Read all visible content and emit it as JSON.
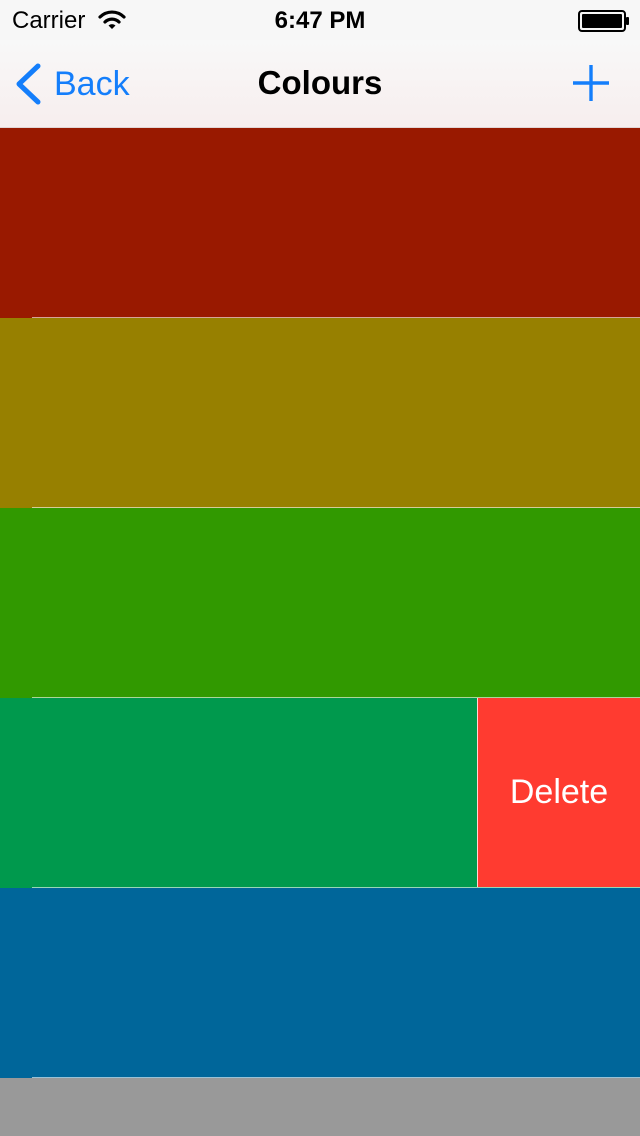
{
  "status_bar": {
    "carrier": "Carrier",
    "time": "6:47 PM"
  },
  "nav_bar": {
    "back_label": "Back",
    "title": "Colours"
  },
  "theme": {
    "tint": "#147efb",
    "delete_color": "#ff3b30"
  },
  "colour_rows": [
    {
      "color": "#991900",
      "swiped": false
    },
    {
      "color": "#978000",
      "swiped": false
    },
    {
      "color": "#319900",
      "swiped": false
    },
    {
      "color": "#00994d",
      "swiped": true,
      "delete_label": "Delete"
    },
    {
      "color": "#00669a",
      "swiped": false
    },
    {
      "color": "#999999",
      "swiped": false
    }
  ]
}
